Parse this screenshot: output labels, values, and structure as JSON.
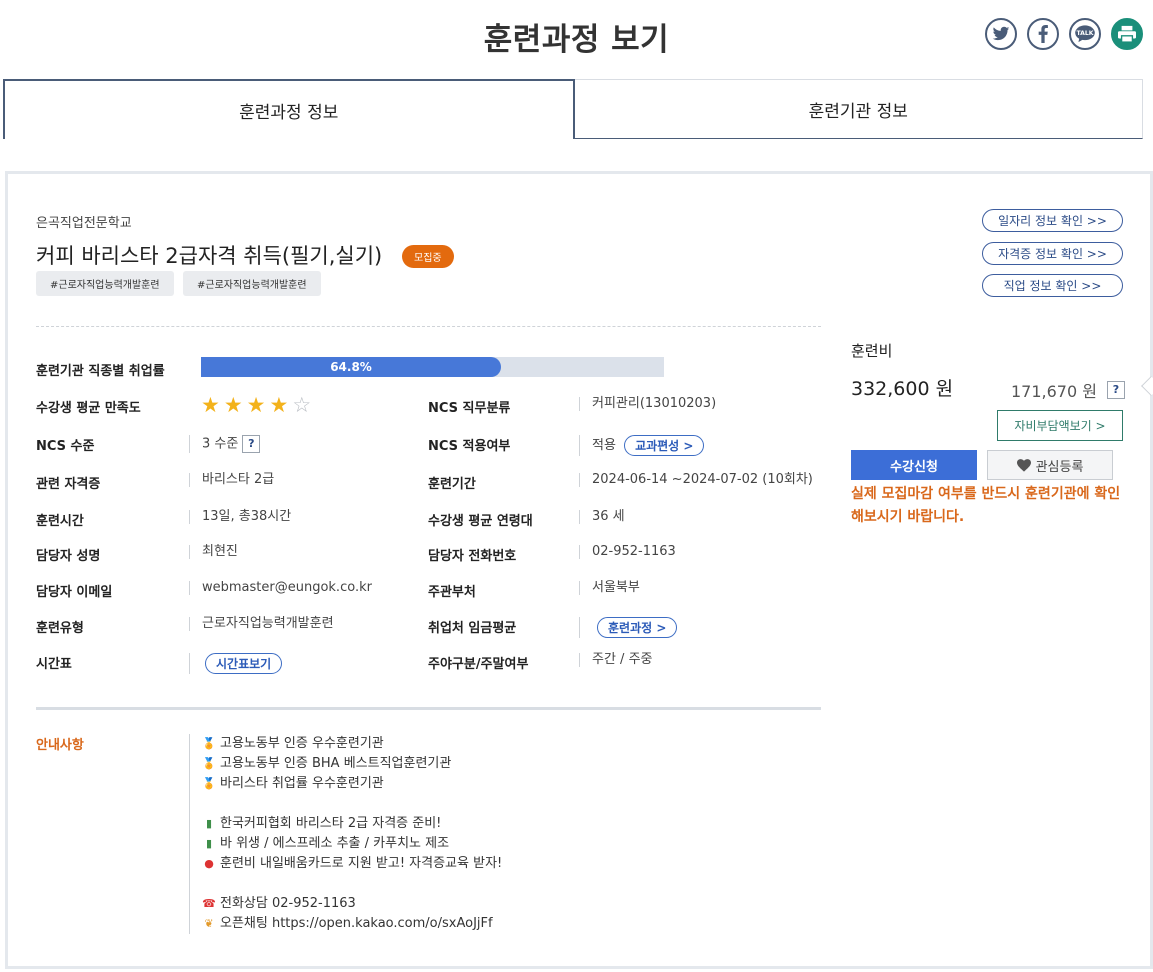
{
  "page": {
    "title": "훈련과정 보기"
  },
  "share": [
    "twitter-icon",
    "facebook-icon",
    "kakaotalk-icon",
    "print-icon"
  ],
  "tabs": [
    {
      "label": "훈련과정 정보",
      "active": true
    },
    {
      "label": "훈련기관 정보",
      "active": false
    }
  ],
  "course": {
    "org": "은곡직업전문학교",
    "title": "커피 바리스타 2급자격 취득(필기,실기)",
    "status_badge": "모집중",
    "tags": [
      "#근로자직업능력개발훈련",
      "#근로자직업능력개발훈련"
    ]
  },
  "links": [
    "일자리 정보 확인 >>",
    "자격증 정보 확인 >>",
    "직업 정보 확인 >>"
  ],
  "info": {
    "employment_label": "훈련기관 직종별 취업률",
    "employment_rate": 64.8,
    "employment_rate_text": "64.8%",
    "satisfaction_label": "수강생 평균 만족도",
    "satisfaction_stars": 4,
    "satisfaction_max": 5,
    "ncs_level_label": "NCS 수준",
    "ncs_level": "3 수준",
    "cert_label": "관련 자격증",
    "cert": "바리스타 2급",
    "hours_label": "훈련시간",
    "hours": "13일, 총38시간",
    "manager_label": "담당자 성명",
    "manager": "최현진",
    "email_label": "담당자 이메일",
    "email": "webmaster@eungok.co.kr",
    "type_label": "훈련유형",
    "type": "근로자직업능력개발훈련",
    "timetable_label": "시간표",
    "timetable_btn": "시간표보기",
    "ncs_class_label": "NCS 직무분류",
    "ncs_class": "커피관리(13010203)",
    "ncs_apply_label": "NCS 적용여부",
    "ncs_apply": "적용",
    "ncs_apply_btn": "교과편성 >",
    "period_label": "훈련기간",
    "period": "2024-06-14 ~2024-07-02 (10회차)",
    "age_label": "수강생 평균 연령대",
    "age": "36 세",
    "phone_label": "담당자 전화번호",
    "phone": "02-952-1163",
    "dept_label": "주관부처",
    "dept": "서울북부",
    "wage_label": "취업처 임금평균",
    "wage_btn": "훈련과정 >",
    "daynight_label": "주야구분/주말여부",
    "daynight": "주간 / 주중",
    "question_mark": "?"
  },
  "notice": {
    "label": "안내사항",
    "lines": [
      {
        "icon": "medal-icon",
        "text": "고용노동부 인증 우수훈련기관"
      },
      {
        "icon": "medal-icon",
        "text": "고용노동부 인증 BHA 베스트직업훈련기관"
      },
      {
        "icon": "medal-icon",
        "text": "바리스타 취업률 우수훈련기관"
      },
      {
        "icon": "",
        "text": ""
      },
      {
        "icon": "books-icon",
        "text": "한국커피협회 바리스타 2급 자격증 준비!"
      },
      {
        "icon": "books-icon",
        "text": "바 위생 / 에스프레소 추출 / 카푸치노 제조"
      },
      {
        "icon": "pushpin-icon",
        "text": "훈련비 내일배움카드로 지원 받고! 자격증교육 받자!"
      },
      {
        "icon": "",
        "text": ""
      },
      {
        "icon": "phone-icon",
        "text": "전화상담 02-952-1163"
      },
      {
        "icon": "leaf-icon",
        "text": "오픈채팅 https://open.kakao.com/o/sxAoJjFf"
      }
    ]
  },
  "fee": {
    "label": "훈련비",
    "price": "332,600 원",
    "self_pay": "171,670 원",
    "self_pay_btn": "자비부담액보기 >",
    "apply_btn": "수강신청",
    "fav_btn": "관심등록",
    "warning": "실제 모집마감 여부를 반드시 훈련기관에 확인해보시기 바랍니다."
  },
  "colors": {
    "accent_blue": "#3c6ed7",
    "orange": "#e36a0e",
    "navy": "#4a5c78",
    "teal": "#1a8f7a",
    "star": "#f3b21b"
  }
}
